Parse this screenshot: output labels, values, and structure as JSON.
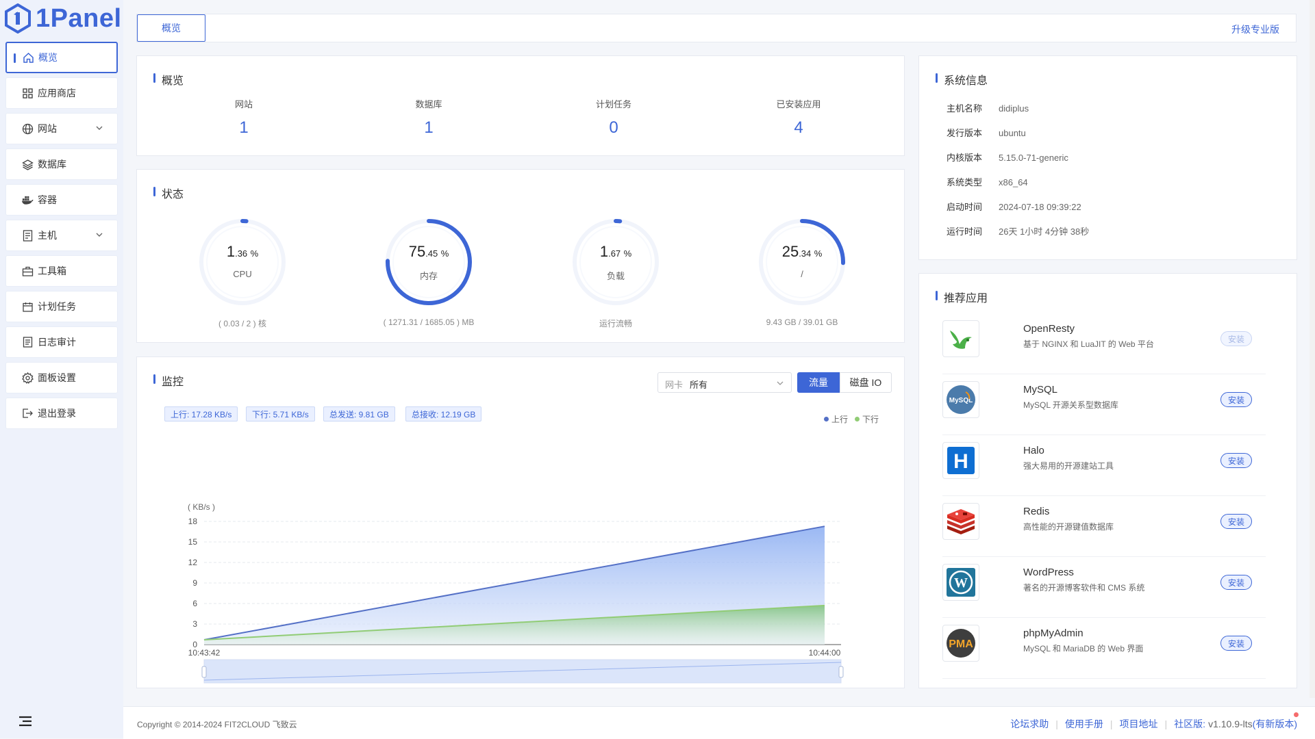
{
  "app": {
    "logo_text": "1Panel"
  },
  "sidebar": {
    "items": [
      {
        "label": "概览",
        "icon": "home-icon",
        "active": true
      },
      {
        "label": "应用商店",
        "icon": "grid-icon"
      },
      {
        "label": "网站",
        "icon": "globe-icon",
        "expandable": true
      },
      {
        "label": "数据库",
        "icon": "layers-icon"
      },
      {
        "label": "容器",
        "icon": "docker-icon"
      },
      {
        "label": "主机",
        "icon": "server-icon",
        "expandable": true
      },
      {
        "label": "工具箱",
        "icon": "toolbox-icon"
      },
      {
        "label": "计划任务",
        "icon": "calendar-icon"
      },
      {
        "label": "日志审计",
        "icon": "log-icon"
      },
      {
        "label": "面板设置",
        "icon": "gear-icon"
      },
      {
        "label": "退出登录",
        "icon": "logout-icon"
      }
    ]
  },
  "header": {
    "tab_label": "概览",
    "upgrade_label": "升级专业版"
  },
  "overview": {
    "title": "概览",
    "stats": [
      {
        "label": "网站",
        "value": "1"
      },
      {
        "label": "数据库",
        "value": "1"
      },
      {
        "label": "计划任务",
        "value": "0"
      },
      {
        "label": "已安装应用",
        "value": "4"
      }
    ]
  },
  "status": {
    "title": "状态",
    "gauges": [
      {
        "int": "1",
        "dec": ".36",
        "unit": "%",
        "name": "CPU",
        "foot": "( 0.03 / 2 ) 核",
        "percent": 1.36
      },
      {
        "int": "75",
        "dec": ".45",
        "unit": "%",
        "name": "内存",
        "foot": "( 1271.31 / 1685.05 ) MB",
        "percent": 75.45
      },
      {
        "int": "1",
        "dec": ".67",
        "unit": "%",
        "name": "负载",
        "foot": "运行流畅",
        "percent": 1.67
      },
      {
        "int": "25",
        "dec": ".34",
        "unit": "%",
        "name": "/",
        "foot": "9.43 GB / 39.01 GB",
        "percent": 25.34
      }
    ]
  },
  "monitor": {
    "title": "监控",
    "nic_label": "网卡",
    "nic_value": "所有",
    "seg_on": "流量",
    "seg_off": "磁盘 IO",
    "tags": [
      "上行: 17.28 KB/s",
      "下行: 5.71 KB/s",
      "总发送: 9.81 GB",
      "总接收: 12.19 GB"
    ],
    "legend_up": "上行",
    "legend_down": "下行"
  },
  "chart_data": {
    "type": "area",
    "ylabel": "( KB/s )",
    "x": [
      "10:43:42",
      "10:44:00"
    ],
    "ylim": [
      0,
      18
    ],
    "yticks": [
      0,
      3,
      6,
      9,
      12,
      15,
      18
    ],
    "series": [
      {
        "name": "上行",
        "values": [
          0.7,
          17.28
        ],
        "color": "#5470c6"
      },
      {
        "name": "下行",
        "values": [
          0.7,
          5.71
        ],
        "color": "#91cc75"
      }
    ],
    "grid": true,
    "legend": "top-right"
  },
  "system_info": {
    "title": "系统信息",
    "rows": [
      {
        "key": "主机名称",
        "value": "didiplus"
      },
      {
        "key": "发行版本",
        "value": "ubuntu"
      },
      {
        "key": "内核版本",
        "value": "5.15.0-71-generic"
      },
      {
        "key": "系统类型",
        "value": "x86_64"
      },
      {
        "key": "启动时间",
        "value": "2024-07-18 09:39:22"
      },
      {
        "key": "运行时间",
        "value": "26天 1小时 4分钟 38秒"
      }
    ]
  },
  "recommended": {
    "title": "推荐应用",
    "apps": [
      {
        "name": "OpenResty",
        "desc": "基于 NGINX 和 LuaJIT 的 Web 平台",
        "btn": "安装",
        "disabled": true,
        "icon": "openresty-icon"
      },
      {
        "name": "MySQL",
        "desc": "MySQL 开源关系型数据库",
        "btn": "安装",
        "icon": "mysql-icon",
        "icon_text": "MySQL"
      },
      {
        "name": "Halo",
        "desc": "强大易用的开源建站工具",
        "btn": "安装",
        "icon": "halo-icon",
        "icon_text": "H"
      },
      {
        "name": "Redis",
        "desc": "高性能的开源键值数据库",
        "btn": "安装",
        "icon": "redis-icon"
      },
      {
        "name": "WordPress",
        "desc": "著名的开源博客软件和 CMS 系统",
        "btn": "安装",
        "icon": "wordpress-icon",
        "icon_text": "W"
      },
      {
        "name": "phpMyAdmin",
        "desc": "MySQL 和 MariaDB 的 Web 界面",
        "btn": "安装",
        "icon": "phpmyadmin-icon",
        "icon_text": "PMA"
      }
    ]
  },
  "footer": {
    "copyright": "Copyright © 2014-2024 FIT2CLOUD 飞致云",
    "links": [
      "论坛求助",
      "使用手册",
      "项目地址"
    ],
    "edition_label": "社区版:",
    "version": "v1.10.9-lts",
    "update_label": "(有新版本)"
  }
}
